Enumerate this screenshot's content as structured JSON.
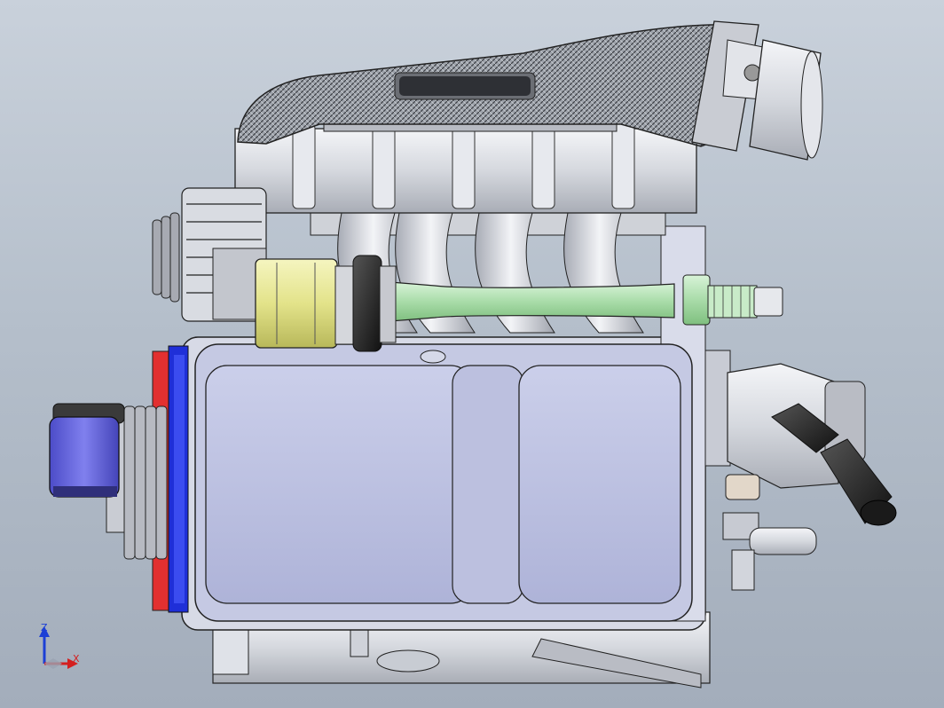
{
  "viewport": {
    "background_top": "#c9d1db",
    "background_bottom": "#a3adbb"
  },
  "triad": {
    "z_label": "Z",
    "x_label": "X",
    "z_color": "#1c3fd6",
    "x_color": "#d41f1f"
  },
  "model": {
    "components": [
      "intake-manifold-carbon",
      "throttle-body",
      "intake-runners",
      "oil-sump",
      "drive-shaft",
      "shaft-coupling",
      "crank-pulley",
      "engine-mount",
      "water-outlet",
      "alternator"
    ],
    "colors": {
      "sump": "#b8bde0",
      "shaft": "#b8e6b8",
      "coupling": "#e8e89a",
      "mount": "#6a6ae0",
      "flange": "#e23030",
      "flange_blue": "#1f2fd8"
    }
  }
}
